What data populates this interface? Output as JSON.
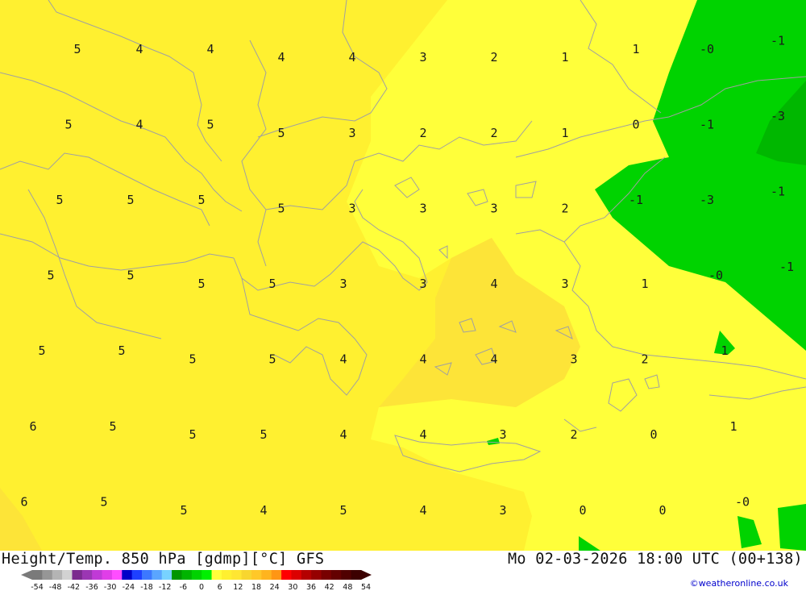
{
  "map": {
    "colors": {
      "zone_4_5": "#fff030",
      "zone_2_3": "#ffff3a",
      "zone_warm": "#fde438",
      "zone_warmer": "#f8d62f",
      "zone_neg": "#00d300",
      "zone_neg_dark": "#00b700",
      "coast": "#a0a0a0"
    },
    "labels": [
      {
        "text": "5",
        "x": 20.0,
        "y": 42.4
      },
      {
        "text": "4",
        "x": 20.7,
        "y": 42.4
      },
      {
        "text": "4",
        "x": 21.5,
        "y": 42.4
      },
      {
        "text": "4",
        "x": 22.3,
        "y": 42.3
      },
      {
        "text": "4",
        "x": 23.1,
        "y": 42.3
      },
      {
        "text": "3",
        "x": 23.9,
        "y": 42.3
      },
      {
        "text": "2",
        "x": 24.7,
        "y": 42.3
      },
      {
        "text": "1",
        "x": 25.5,
        "y": 42.3
      },
      {
        "text": "1",
        "x": 26.3,
        "y": 42.4
      },
      {
        "text": "-0",
        "x": 27.1,
        "y": 42.4
      },
      {
        "text": "-1",
        "x": 27.9,
        "y": 42.5
      },
      {
        "text": "5",
        "x": 19.9,
        "y": 41.5
      },
      {
        "text": "4",
        "x": 20.7,
        "y": 41.5
      },
      {
        "text": "5",
        "x": 21.5,
        "y": 41.5
      },
      {
        "text": "5",
        "x": 22.3,
        "y": 41.4
      },
      {
        "text": "3",
        "x": 23.1,
        "y": 41.4
      },
      {
        "text": "2",
        "x": 23.9,
        "y": 41.4
      },
      {
        "text": "2",
        "x": 24.7,
        "y": 41.4
      },
      {
        "text": "1",
        "x": 25.5,
        "y": 41.4
      },
      {
        "text": "0",
        "x": 26.3,
        "y": 41.5
      },
      {
        "text": "-1",
        "x": 27.1,
        "y": 41.5
      },
      {
        "text": "-3",
        "x": 27.9,
        "y": 41.6
      },
      {
        "text": "5",
        "x": 19.8,
        "y": 40.6
      },
      {
        "text": "5",
        "x": 20.6,
        "y": 40.6
      },
      {
        "text": "5",
        "x": 21.4,
        "y": 40.6
      },
      {
        "text": "5",
        "x": 22.3,
        "y": 40.5
      },
      {
        "text": "3",
        "x": 23.1,
        "y": 40.5
      },
      {
        "text": "3",
        "x": 23.9,
        "y": 40.5
      },
      {
        "text": "3",
        "x": 24.7,
        "y": 40.5
      },
      {
        "text": "2",
        "x": 25.5,
        "y": 40.5
      },
      {
        "text": "-1",
        "x": 26.3,
        "y": 40.6
      },
      {
        "text": "-3",
        "x": 27.1,
        "y": 40.6
      },
      {
        "text": "-1",
        "x": 27.9,
        "y": 40.7
      },
      {
        "text": "5",
        "x": 19.7,
        "y": 39.7
      },
      {
        "text": "5",
        "x": 20.6,
        "y": 39.7
      },
      {
        "text": "5",
        "x": 21.4,
        "y": 39.6
      },
      {
        "text": "5",
        "x": 22.2,
        "y": 39.6
      },
      {
        "text": "3",
        "x": 23.0,
        "y": 39.6
      },
      {
        "text": "3",
        "x": 23.9,
        "y": 39.6
      },
      {
        "text": "4",
        "x": 24.7,
        "y": 39.6
      },
      {
        "text": "3",
        "x": 25.5,
        "y": 39.6
      },
      {
        "text": "1",
        "x": 26.4,
        "y": 39.6
      },
      {
        "text": "-0",
        "x": 27.2,
        "y": 39.7
      },
      {
        "text": "-1",
        "x": 28.0,
        "y": 39.8
      },
      {
        "text": "5",
        "x": 19.6,
        "y": 38.8
      },
      {
        "text": "5",
        "x": 20.5,
        "y": 38.8
      },
      {
        "text": "5",
        "x": 21.3,
        "y": 38.7
      },
      {
        "text": "5",
        "x": 22.2,
        "y": 38.7
      },
      {
        "text": "4",
        "x": 23.0,
        "y": 38.7
      },
      {
        "text": "4",
        "x": 23.9,
        "y": 38.7
      },
      {
        "text": "4",
        "x": 24.7,
        "y": 38.7
      },
      {
        "text": "3",
        "x": 25.6,
        "y": 38.7
      },
      {
        "text": "2",
        "x": 26.4,
        "y": 38.7
      },
      {
        "text": "1",
        "x": 27.3,
        "y": 38.8
      },
      {
        "text": "6",
        "x": 19.5,
        "y": 37.9
      },
      {
        "text": "5",
        "x": 20.4,
        "y": 37.9
      },
      {
        "text": "5",
        "x": 21.3,
        "y": 37.8
      },
      {
        "text": "5",
        "x": 22.1,
        "y": 37.8
      },
      {
        "text": "4",
        "x": 23.0,
        "y": 37.8
      },
      {
        "text": "4",
        "x": 23.9,
        "y": 37.8
      },
      {
        "text": "3",
        "x": 24.8,
        "y": 37.8
      },
      {
        "text": "2",
        "x": 25.6,
        "y": 37.8
      },
      {
        "text": "0",
        "x": 26.5,
        "y": 37.8
      },
      {
        "text": "1",
        "x": 27.4,
        "y": 37.9
      },
      {
        "text": "6",
        "x": 19.4,
        "y": 37.0
      },
      {
        "text": "5",
        "x": 20.3,
        "y": 37.0
      },
      {
        "text": "5",
        "x": 21.2,
        "y": 36.9
      },
      {
        "text": "4",
        "x": 22.1,
        "y": 36.9
      },
      {
        "text": "5",
        "x": 23.0,
        "y": 36.9
      },
      {
        "text": "4",
        "x": 23.9,
        "y": 36.9
      },
      {
        "text": "3",
        "x": 24.8,
        "y": 36.9
      },
      {
        "text": "0",
        "x": 25.7,
        "y": 36.9
      },
      {
        "text": "0",
        "x": 26.6,
        "y": 36.9
      },
      {
        "text": "-0",
        "x": 27.5,
        "y": 37.0
      }
    ]
  },
  "footer": {
    "title_left": "Height/Temp. 850 hPa [gdmp][°C] GFS",
    "title_right": "Mo 02-03-2026 18:00 UTC (00+138)",
    "credit": "©weatheronline.co.uk",
    "legend": {
      "ticks": [
        "-54",
        "-48",
        "-42",
        "-36",
        "-30",
        "-24",
        "-18",
        "-12",
        "-6",
        "0",
        "6",
        "12",
        "18",
        "24",
        "30",
        "36",
        "42",
        "48",
        "54"
      ],
      "colors": [
        "#7a7a7a",
        "#969696",
        "#b4b4b4",
        "#d2d2d2",
        "#7b2b8e",
        "#9b36b3",
        "#c03ad6",
        "#e03ee8",
        "#ff4dff",
        "#0000c8",
        "#1e40ff",
        "#3c78ff",
        "#5aa5ff",
        "#78d2ff",
        "#009600",
        "#00b400",
        "#00d200",
        "#00f000",
        "#ffff3a",
        "#fff030",
        "#ffe632",
        "#f8d62f",
        "#ffc828",
        "#ffb41e",
        "#ff9614",
        "#ff0000",
        "#dc0000",
        "#b40000",
        "#960000",
        "#780000",
        "#640000",
        "#500000",
        "#3c0000"
      ]
    }
  }
}
